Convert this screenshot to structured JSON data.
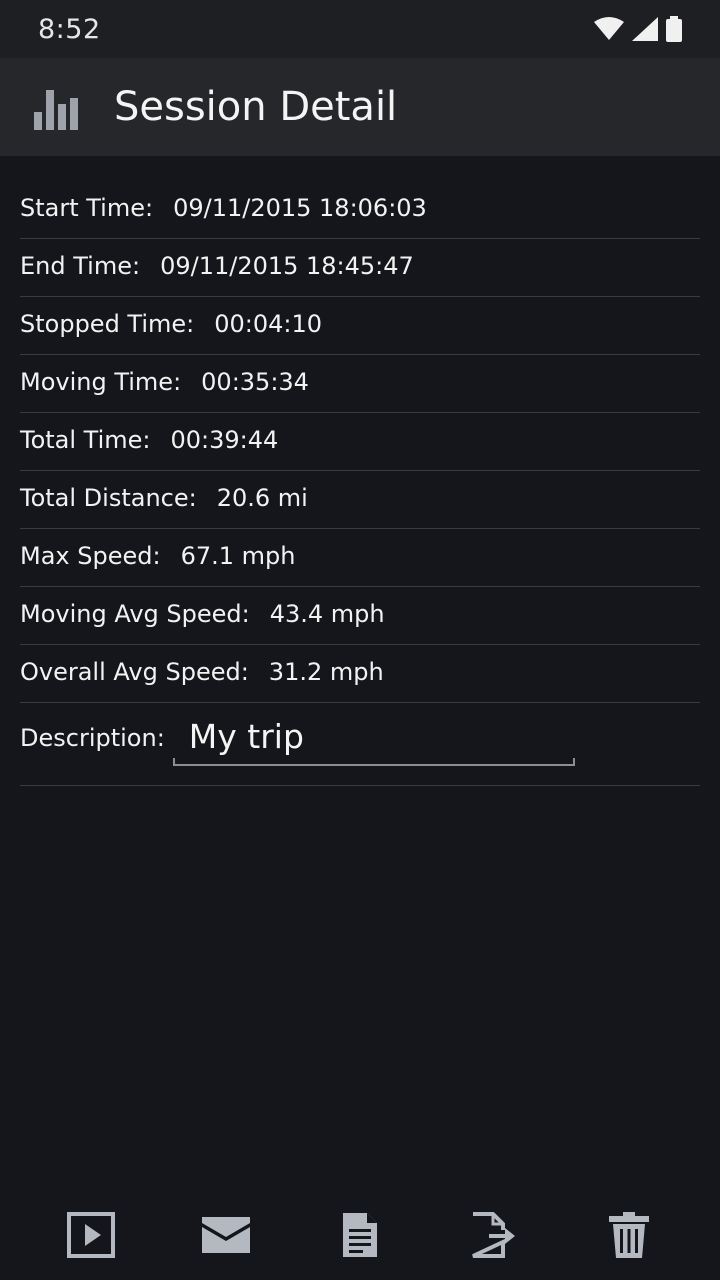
{
  "status_bar": {
    "time": "8:52"
  },
  "app_bar": {
    "title": "Session Detail"
  },
  "details": [
    {
      "label": "Start Time:",
      "value": "09/11/2015 18:06:03"
    },
    {
      "label": "End Time:",
      "value": "09/11/2015 18:45:47"
    },
    {
      "label": "Stopped Time:",
      "value": "00:04:10"
    },
    {
      "label": "Moving Time:",
      "value": "00:35:34"
    },
    {
      "label": "Total Time:",
      "value": "00:39:44"
    },
    {
      "label": "Total Distance:",
      "value": "20.6 mi"
    },
    {
      "label": "Max Speed:",
      "value": "67.1 mph"
    },
    {
      "label": "Moving Avg Speed:",
      "value": "43.4 mph"
    },
    {
      "label": "Overall Avg Speed:",
      "value": "31.2 mph"
    }
  ],
  "description": {
    "label": "Description:",
    "value": "My trip"
  },
  "toolbar": {
    "icons": [
      "play-icon",
      "mail-icon",
      "document-icon",
      "export-icon",
      "trash-icon"
    ]
  },
  "colors": {
    "background": "#15161c",
    "app_bar": "#26272b",
    "status_bar": "#1e1f22",
    "icon_gray": "#b4b8c0",
    "divider": "#3a3b40"
  }
}
